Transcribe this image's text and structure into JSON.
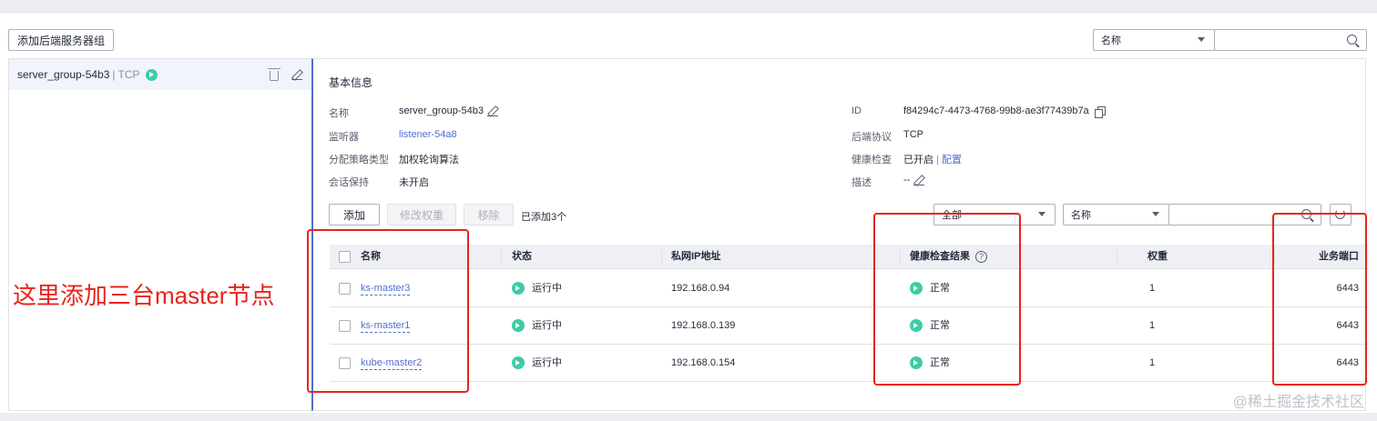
{
  "toolbar": {
    "add_group_button": "添加后端服务器组",
    "filter_select": "名称"
  },
  "group_list": {
    "items": [
      {
        "name": "server_group-54b3",
        "separator": "|",
        "protocol": "TCP"
      }
    ]
  },
  "basic_info": {
    "title": "基本信息",
    "name_label": "名称",
    "name_value": "server_group-54b3",
    "listener_label": "监听器",
    "listener_value": "listener-54a8",
    "algorithm_label": "分配策略类型",
    "algorithm_value": "加权轮询算法",
    "session_label": "会话保持",
    "session_value": "未开启",
    "id_label": "ID",
    "id_value": "f84294c7-4473-4768-99b8-ae3f77439b7a",
    "protocol_label": "后端协议",
    "protocol_value": "TCP",
    "health_label": "健康检查",
    "health_value": "已开启",
    "health_sep": "|",
    "health_config": "配置",
    "desc_label": "描述",
    "desc_value": "--"
  },
  "actions": {
    "add": "添加",
    "modify_weight": "修改权重",
    "remove": "移除",
    "added_count": "已添加3个",
    "status_filter": "全部",
    "name_filter": "名称"
  },
  "table": {
    "headers": {
      "name": "名称",
      "status": "状态",
      "ip": "私网IP地址",
      "health": "健康检查结果",
      "weight": "权重",
      "port": "业务端口"
    },
    "rows": [
      {
        "name": "ks-master3",
        "status": "运行中",
        "ip": "192.168.0.94",
        "health": "正常",
        "weight": "1",
        "port": "6443"
      },
      {
        "name": "ks-master1",
        "status": "运行中",
        "ip": "192.168.0.139",
        "health": "正常",
        "weight": "1",
        "port": "6443"
      },
      {
        "name": "kube-master2",
        "status": "运行中",
        "ip": "192.168.0.154",
        "health": "正常",
        "weight": "1",
        "port": "6443"
      }
    ]
  },
  "annotation": "这里添加三台master节点",
  "watermark": "@稀土掘金技术社区",
  "colors": {
    "accent": "#526ecc",
    "success": "#3dcca6",
    "annotation_red": "#e8231a"
  }
}
